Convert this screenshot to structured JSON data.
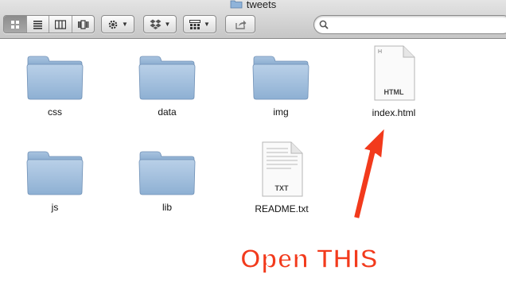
{
  "window": {
    "title": "tweets"
  },
  "toolbar": {
    "view_buttons": [
      "icon-view-icon",
      "list-view-icon",
      "column-view-icon",
      "coverflow-view-icon"
    ],
    "action_menu_icon": "gear-icon",
    "dropbox_menu_icon": "dropbox-icon",
    "arrange_menu_icon": "arrange-grid-icon",
    "share_icon": "share-icon"
  },
  "search": {
    "value": "",
    "placeholder": ""
  },
  "files": [
    {
      "name": "css",
      "kind": "folder"
    },
    {
      "name": "data",
      "kind": "folder"
    },
    {
      "name": "img",
      "kind": "folder"
    },
    {
      "name": "index.html",
      "kind": "document",
      "badge": "HTML"
    },
    {
      "name": "js",
      "kind": "folder"
    },
    {
      "name": "lib",
      "kind": "folder"
    },
    {
      "name": "README.txt",
      "kind": "document",
      "badge": "TXT"
    }
  ],
  "annotation": {
    "text": "Open THIS",
    "color": "#f23a1c"
  }
}
